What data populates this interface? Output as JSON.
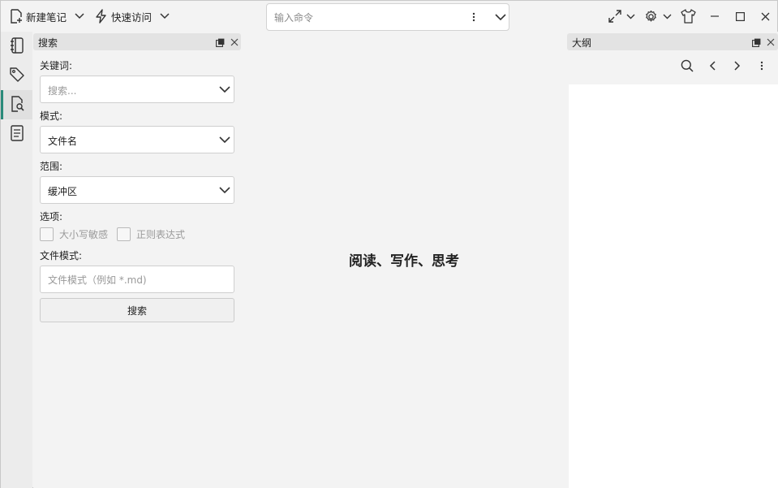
{
  "titlebar": {
    "new_note": "新建笔记",
    "quick_access": "快速访问",
    "command_placeholder": "输入命令"
  },
  "activity_bar": {
    "items": [
      "notebook-icon",
      "tag-icon",
      "search-file-icon",
      "outline-doc-icon"
    ],
    "active_index": 2,
    "accent_color": "#2a8a7a"
  },
  "search_panel": {
    "title": "搜索",
    "keyword_label": "关键词:",
    "keyword_placeholder": "搜索...",
    "mode_label": "模式:",
    "mode_value": "文件名",
    "scope_label": "范围:",
    "scope_value": "缓冲区",
    "options_label": "选项:",
    "option_case": "大小写敏感",
    "option_regex": "正则表达式",
    "file_pattern_label": "文件模式:",
    "file_pattern_placeholder": "文件模式（例如 *.md)",
    "search_button": "搜索"
  },
  "center": {
    "slogan": "阅读、写作、思考"
  },
  "outline_panel": {
    "title": "大纲"
  }
}
